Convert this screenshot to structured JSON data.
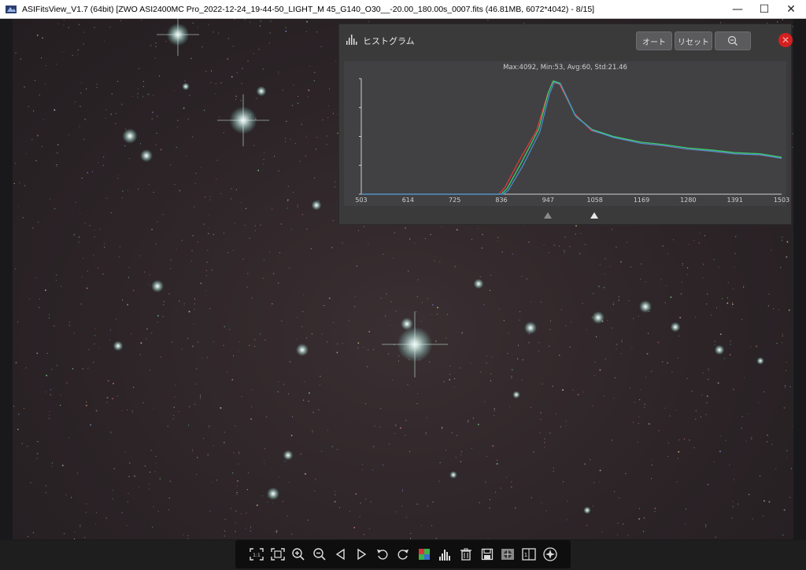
{
  "window": {
    "title": "ASIFitsView_V1.7 (64bit) [ZWO ASI2400MC Pro_2022-12-24_19-44-50_LIGHT_M 45_G140_O30__-20.00_180.00s_0007.fits (46.81MB, 6072*4042) - 8/15]",
    "minimize": "—",
    "maximize": "☐",
    "close": "✕"
  },
  "histogram": {
    "title": "ヒストグラム",
    "auto_label": "オート",
    "reset_label": "リセット",
    "stats": "Max:4092, Min:53, Avg:60, Std:21.46",
    "close_icon": "✕"
  },
  "chart_data": {
    "type": "line",
    "x_ticks": [
      "503",
      "614",
      "725",
      "836",
      "947",
      "1058",
      "1169",
      "1280",
      "1391",
      "1503"
    ],
    "xlim": [
      503,
      1503
    ],
    "series": [
      {
        "color": "#e83a3a",
        "x": [
          503,
          830,
          845,
          880,
          920,
          945,
          958,
          975,
          1010,
          1050,
          1100,
          1169,
          1220,
          1280,
          1340,
          1391,
          1450,
          1503
        ],
        "y": [
          0,
          0,
          0.06,
          0.3,
          0.55,
          0.85,
          0.97,
          0.95,
          0.7,
          0.55,
          0.5,
          0.44,
          0.42,
          0.39,
          0.37,
          0.35,
          0.34,
          0.31
        ]
      },
      {
        "color": "#3ad46a",
        "x": [
          503,
          836,
          850,
          885,
          925,
          948,
          960,
          976,
          1012,
          1052,
          1102,
          1169,
          1222,
          1280,
          1342,
          1391,
          1452,
          1503
        ],
        "y": [
          0,
          0,
          0.05,
          0.28,
          0.56,
          0.88,
          0.98,
          0.96,
          0.68,
          0.56,
          0.5,
          0.45,
          0.43,
          0.4,
          0.38,
          0.36,
          0.35,
          0.32
        ]
      },
      {
        "color": "#4a8fd8",
        "x": [
          503,
          840,
          852,
          888,
          928,
          950,
          962,
          978,
          1014,
          1054,
          1104,
          1169,
          1224,
          1280,
          1344,
          1391,
          1454,
          1503
        ],
        "y": [
          0,
          0,
          0.03,
          0.25,
          0.54,
          0.86,
          0.97,
          0.95,
          0.67,
          0.55,
          0.49,
          0.44,
          0.42,
          0.39,
          0.37,
          0.35,
          0.34,
          0.31
        ]
      }
    ],
    "sliders": {
      "black_point": 947,
      "white_point": 1058
    }
  },
  "toolbar": {
    "items": [
      "fit-to-window-icon",
      "actual-size-icon",
      "zoom-in-icon",
      "zoom-out-icon",
      "previous-icon",
      "next-icon",
      "rotate-left-icon",
      "rotate-right-icon",
      "debayer-icon",
      "histogram-icon",
      "delete-icon",
      "save-icon",
      "stretch-icon",
      "one-to-one-icon",
      "star-detect-icon"
    ]
  }
}
